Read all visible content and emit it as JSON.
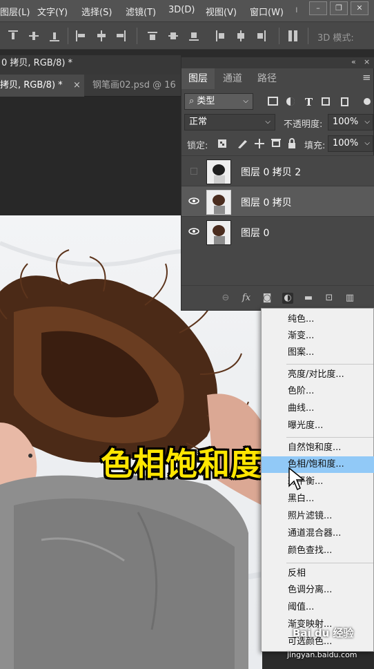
{
  "menubar": {
    "items": [
      "图层(L)",
      "文字(Y)",
      "选择(S)",
      "滤镜(T)",
      "3D(D)",
      "视图(V)",
      "窗口(W)"
    ],
    "window_buttons": [
      "–",
      "❐",
      "✕"
    ]
  },
  "options_bar": {
    "mode_label": "3D 模式:"
  },
  "document_tabs": {
    "tab1": "0 拷贝, RGB/8) *",
    "tab2_active": "拷贝, RGB/8) *",
    "tab2_close": "×",
    "tab2_other": "钢笔画02.psd @ 16"
  },
  "layers_panel": {
    "header_buttons": [
      "«",
      "×"
    ],
    "tabs": [
      "图层",
      "通道",
      "路径"
    ],
    "menu_icon": "≡",
    "filter_kind": "类型",
    "blend_mode": "正常",
    "opacity_label": "不透明度:",
    "opacity_value": "100%",
    "lock_label": "锁定:",
    "fill_label": "填充:",
    "fill_value": "100%",
    "layers": [
      {
        "name": "图层 0 拷贝 2",
        "visible": false,
        "selected": false
      },
      {
        "name": "图层 0 拷贝",
        "visible": true,
        "selected": true
      },
      {
        "name": "图层 0",
        "visible": true,
        "selected": false
      }
    ],
    "footer_fx": "fx"
  },
  "adjustment_menu": {
    "group1": [
      "纯色...",
      "渐变...",
      "图案..."
    ],
    "group2": [
      "亮度/对比度...",
      "色阶...",
      "曲线...",
      "曝光度..."
    ],
    "group3": [
      "自然饱和度...",
      "色相/饱和度...",
      "彩平衡...",
      "黑白...",
      "照片滤镜...",
      "通道混合器...",
      "颜色查找..."
    ],
    "group4": [
      "反相",
      "色调分离...",
      "阈值...",
      "渐变映射...",
      "可选颜色..."
    ],
    "highlighted": "色相/饱和度..."
  },
  "caption": "色相饱和度",
  "watermark": {
    "brand": "Bai du 经验",
    "url": "jingyan.baidu.com"
  },
  "colors": {
    "highlight": "#91c9f7",
    "caption_fill": "#ffe600"
  }
}
